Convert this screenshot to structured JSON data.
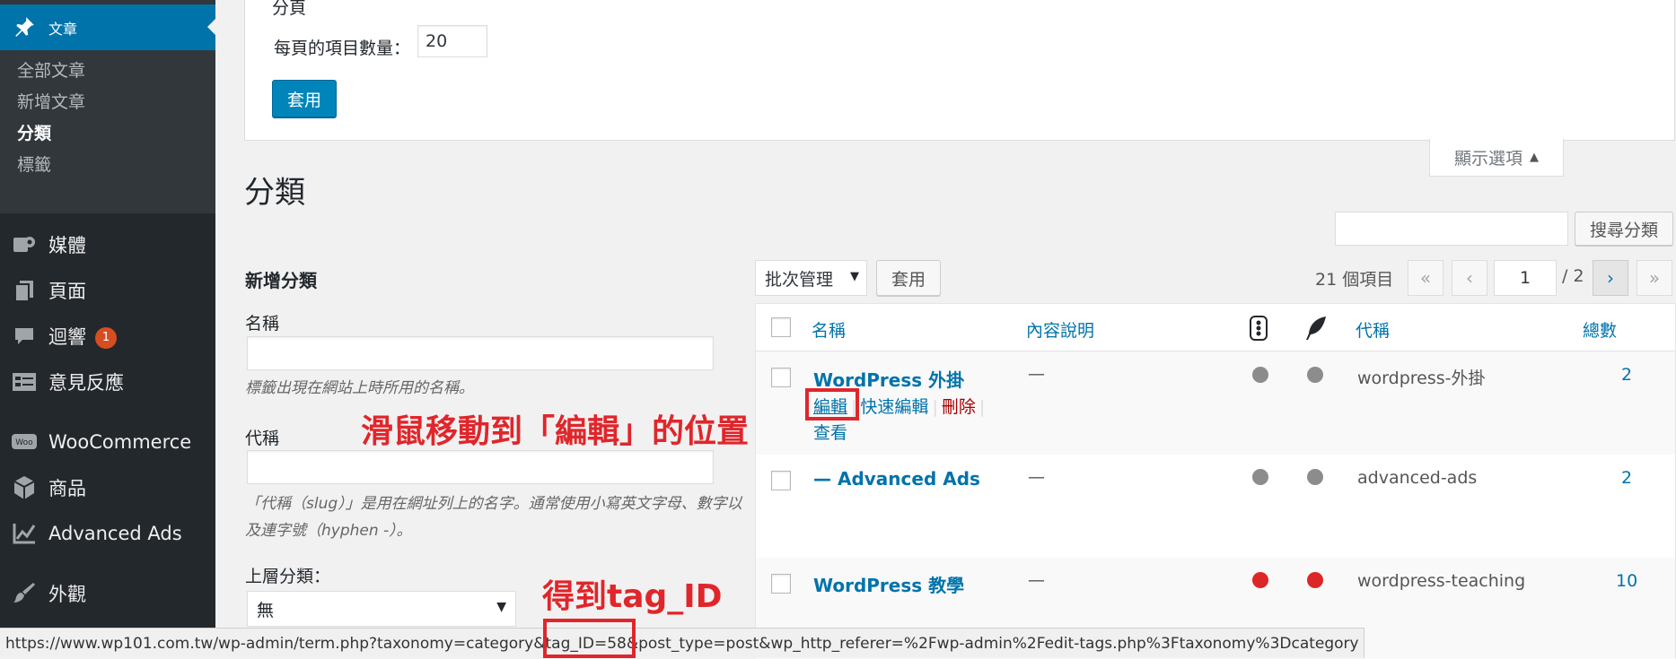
{
  "sidebar": {
    "active": "文章",
    "submenu": [
      "全部文章",
      "新增文章",
      "分類",
      "標籤"
    ],
    "current_sub": "分類",
    "items": [
      {
        "label": "媒體",
        "icon": "media-icon"
      },
      {
        "label": "頁面",
        "icon": "pages-icon"
      },
      {
        "label": "迴響",
        "icon": "comments-icon",
        "badge": "1"
      },
      {
        "label": "意見反應",
        "icon": "feedback-icon"
      },
      {
        "label": "WooCommerce",
        "icon": "woocommerce-icon"
      },
      {
        "label": "商品",
        "icon": "products-icon"
      },
      {
        "label": "Advanced Ads",
        "icon": "advanced-ads-icon"
      },
      {
        "label": "外觀",
        "icon": "appearance-icon"
      }
    ]
  },
  "screen_options": {
    "cut_title": "分頁",
    "per_page_label": "每頁的項目數量：",
    "per_page_value": "20",
    "apply_label": "套用",
    "tab_label": "顯示選項"
  },
  "page": {
    "title": "分類",
    "search_button": "搜尋分類"
  },
  "add_form": {
    "title": "新增分類",
    "name_label": "名稱",
    "name_desc": "標籤出現在網站上時所用的名稱。",
    "slug_label": "代稱",
    "slug_desc": "「代稱（slug）」是用在網址列上的名字。通常使用小寫英文字母、數字以及連字號（hyphen -）。",
    "parent_label": "上層分類：",
    "parent_value": "無"
  },
  "tablenav": {
    "bulk_label": "批次管理",
    "apply_label": "套用",
    "items_count": "21 個項目",
    "first": "«",
    "prev": "‹",
    "current_page": "1",
    "total_pages": "/ 2",
    "next": "›",
    "last": "»"
  },
  "table": {
    "columns": {
      "name": "名稱",
      "description": "內容說明",
      "slug": "代稱",
      "count": "總數"
    },
    "rows": [
      {
        "name": "WordPress 外掛",
        "description": "—",
        "slug": "wordpress-外掛",
        "count": "2",
        "dot_color": "#8c8c8c"
      },
      {
        "name": "— Advanced Ads",
        "description": "—",
        "slug": "advanced-ads",
        "count": "2",
        "dot_color": "#8c8c8c"
      },
      {
        "name": "WordPress 教學",
        "description": "—",
        "slug": "wordpress-teaching",
        "count": "10",
        "dot_color": "#dd2727"
      }
    ],
    "row_actions": {
      "edit": "編輯",
      "quick_edit": "快速編輯",
      "delete": "刪除",
      "view": "查看"
    }
  },
  "annotations": {
    "hover_edit": "滑鼠移動到「編輯」的位置",
    "get_tag_id": "得到tag_ID"
  },
  "status_bar": {
    "url_before": "https://www.wp101.com.tw/wp-admin/term.php?taxonomy=category&",
    "url_highlight": "tag_ID=58",
    "url_after": "&post_type=post&wp_http_referer=%2Fwp-admin%2Fedit-tags.php%3Ftaxonomy%3Dcategory"
  },
  "colors": {
    "accent": "#0073aa",
    "annotation": "#e0262b",
    "sidebar": "#23282d"
  }
}
